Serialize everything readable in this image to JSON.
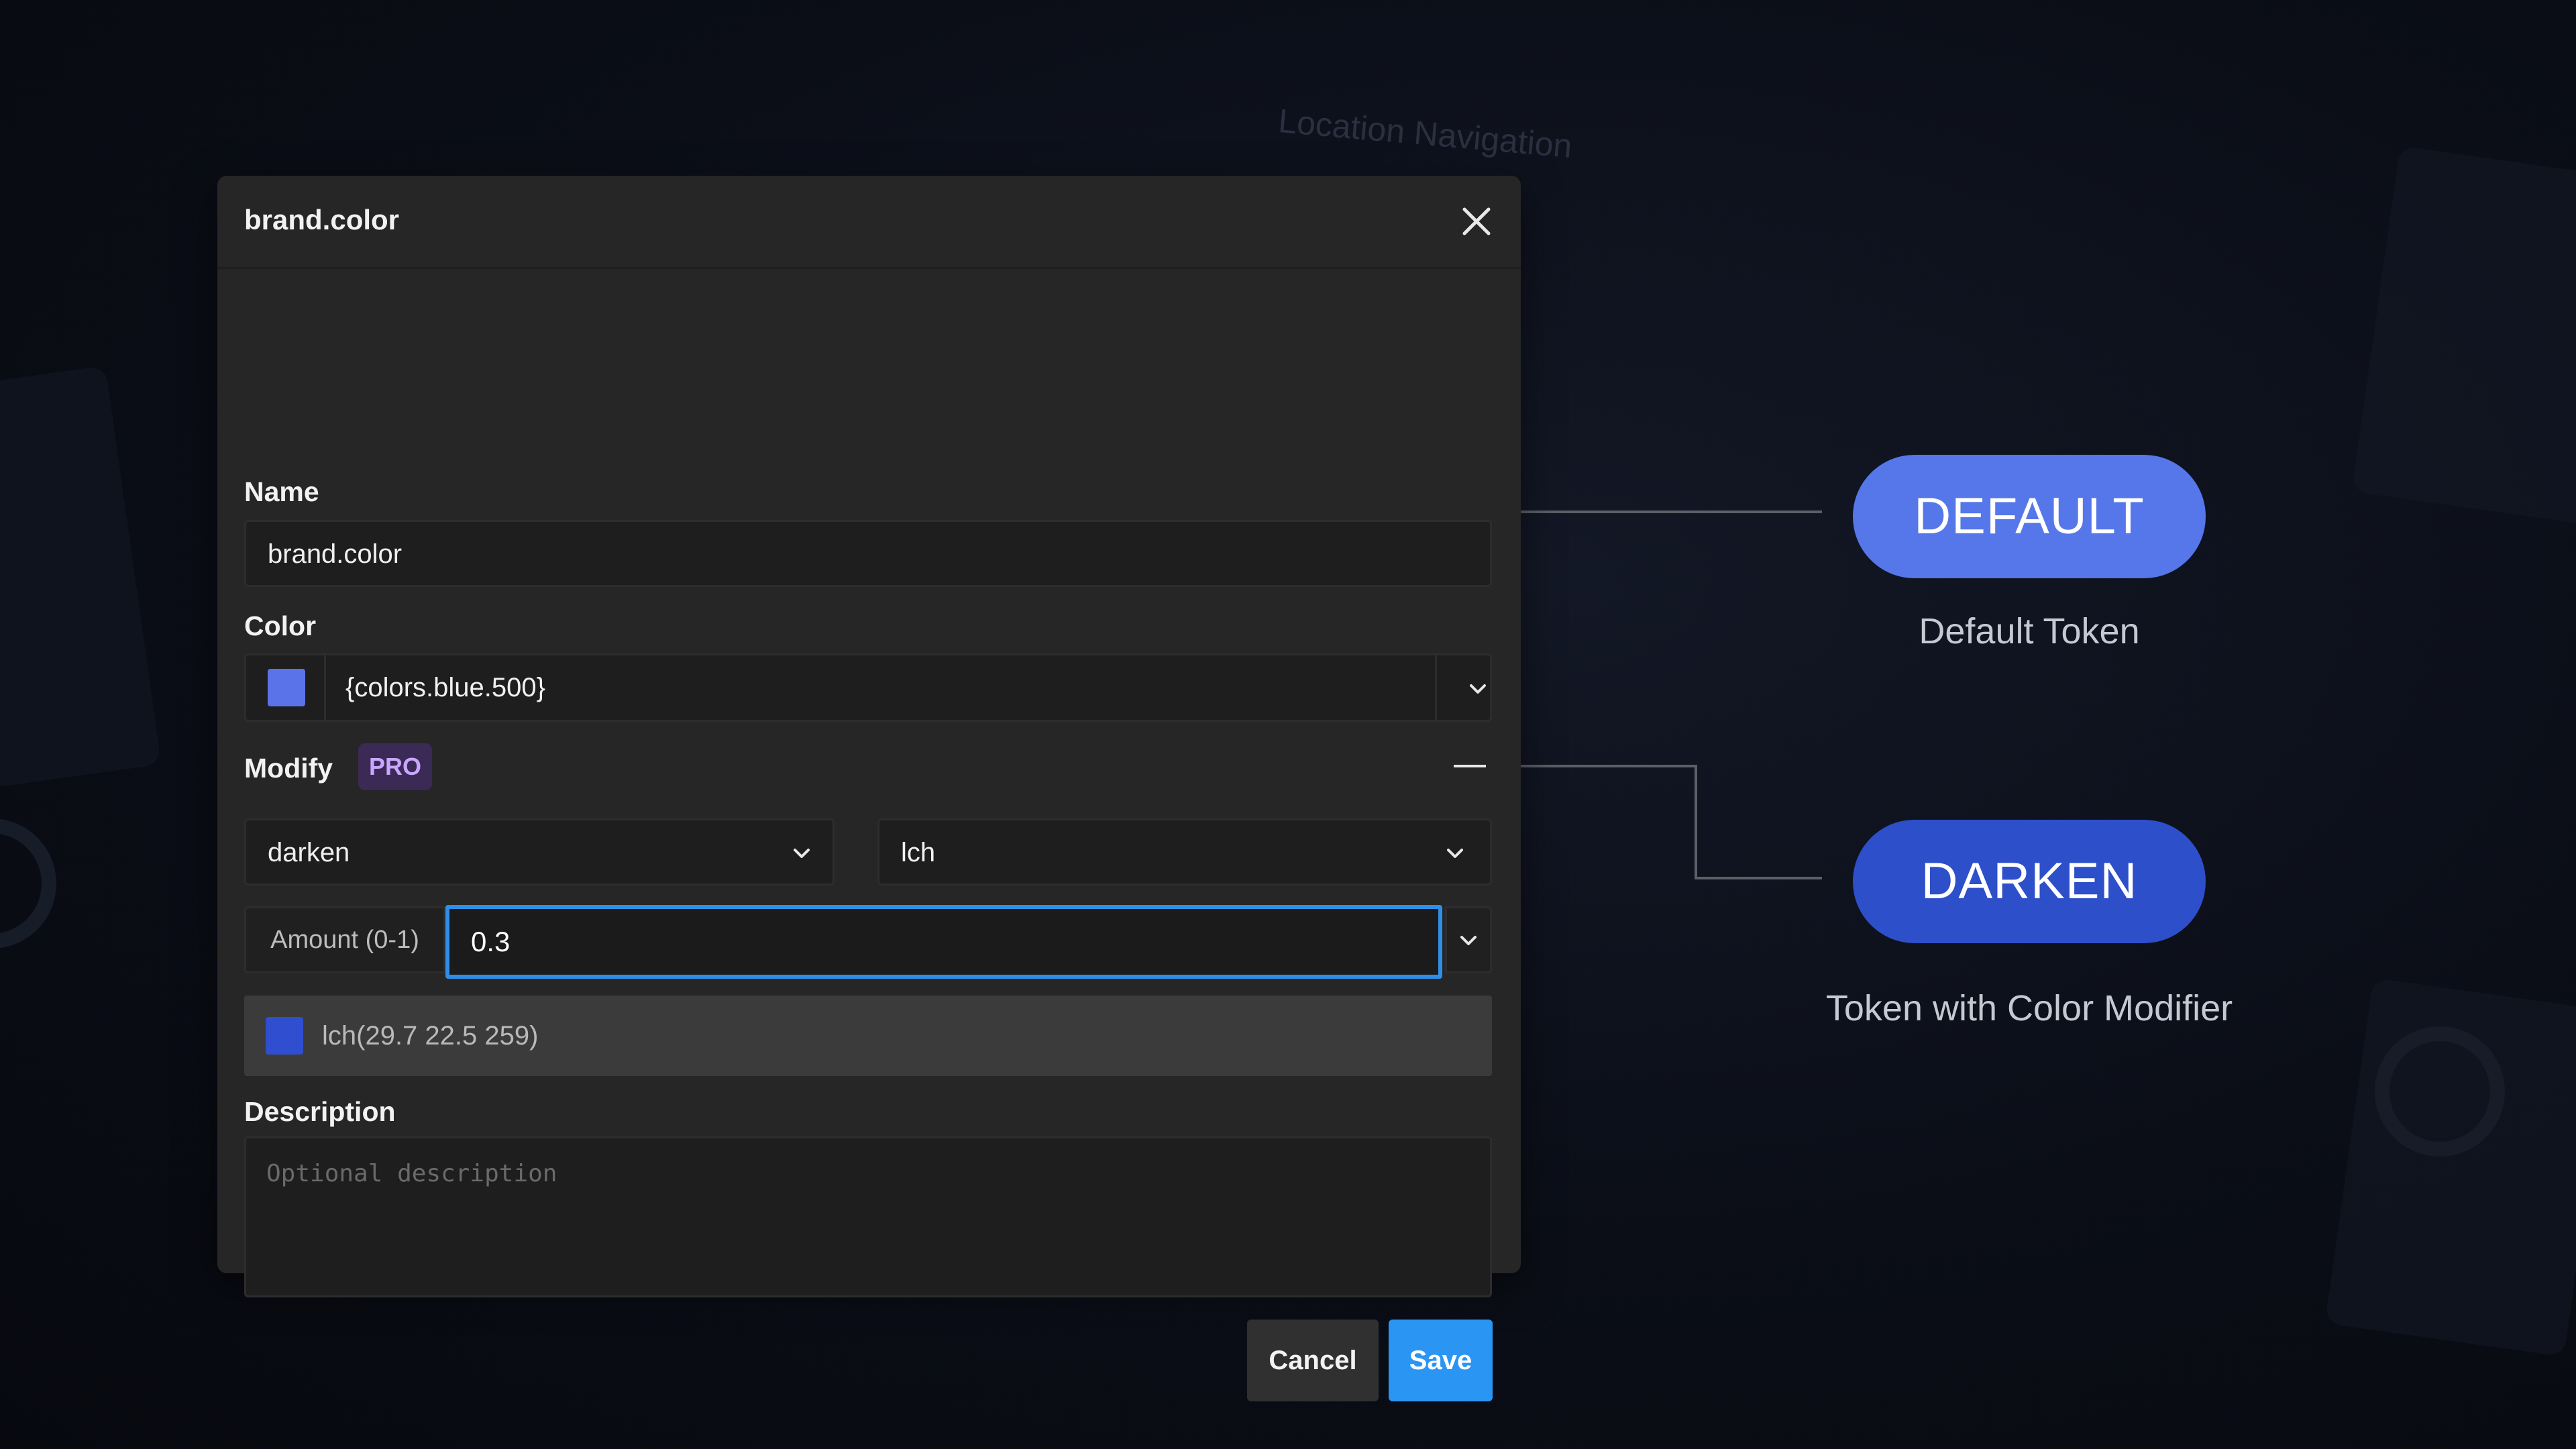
{
  "background": {
    "faint_label": "Location Navigation"
  },
  "dialog": {
    "title": "brand.color",
    "close_icon": "close-icon",
    "name": {
      "label": "Name",
      "value": "brand.color"
    },
    "color": {
      "label": "Color",
      "value": "{colors.blue.500}",
      "swatch": "#5a73e8"
    },
    "modify": {
      "label": "Modify",
      "badge": "PRO",
      "function_select": "darken",
      "space_select": "lch",
      "amount_label": "Amount (0-1)",
      "amount_value": "0.3",
      "preview": {
        "value": "lch(29.7 22.5 259)",
        "swatch": "#2f4fd0"
      }
    },
    "description": {
      "label": "Description",
      "placeholder": "Optional description"
    },
    "buttons": {
      "cancel": "Cancel",
      "save": "Save"
    }
  },
  "tokens": [
    {
      "pill": "DEFAULT",
      "caption": "Default Token",
      "color": "#5577ea"
    },
    {
      "pill": "DARKEN",
      "caption": "Token with Color Modifier",
      "color": "#2d4fca"
    }
  ]
}
